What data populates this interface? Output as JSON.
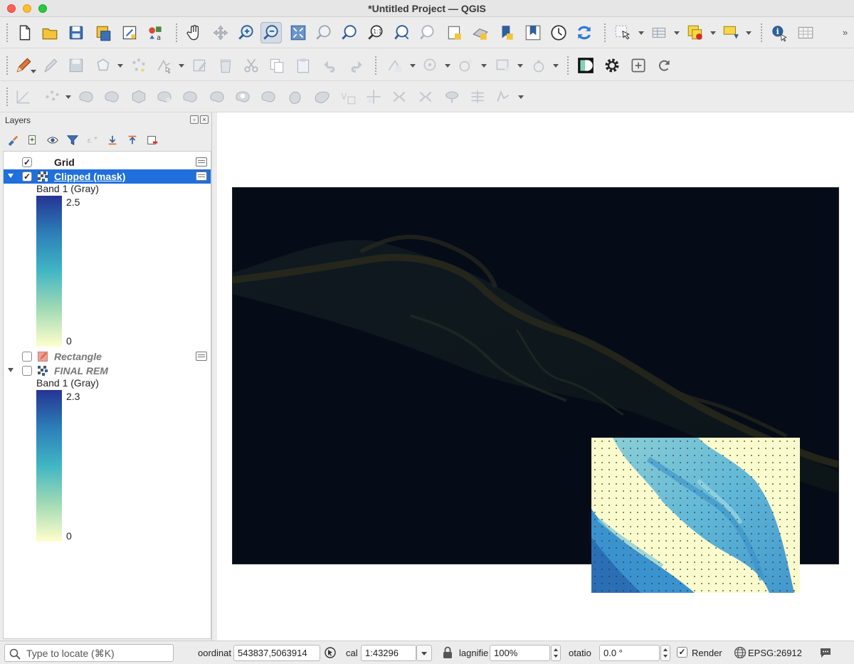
{
  "window": {
    "title": "*Untitled Project — QGIS"
  },
  "colors": {
    "accent": "#1f6fdc",
    "raster_bg": "#060b18",
    "ramp_top": "#253494",
    "ramp_bottom": "#ffffcc"
  },
  "toolbars": {
    "row1": [
      "new-project-icon",
      "open-project-icon",
      "save-project-icon",
      "save-as-icon",
      "print-layout-icon",
      "style-manager-icon",
      "pan-icon",
      "pan-to-selection-icon",
      "zoom-in-icon",
      "zoom-out-icon",
      "zoom-full-icon",
      "zoom-to-selection-icon",
      "zoom-to-layer-icon",
      "zoom-native-icon",
      "zoom-last-icon",
      "zoom-next-icon",
      "new-map-view-icon",
      "new-3d-map-view-icon",
      "new-bookmark-icon",
      "show-bookmarks-icon",
      "temporal-controller-icon",
      "refresh-icon",
      "select-features-icon",
      "attribute-table-icon",
      "deselect-icon",
      "annotation-icon",
      "identify-icon",
      "measure-icon"
    ],
    "row2": [
      "digitize-pencil-icon",
      "edit-pencil-icon",
      "save-edits-icon",
      "add-polygon-icon",
      "vertex-tool-icon",
      "node-tool-icon",
      "delete-selected-icon",
      "cut-icon",
      "copy-icon",
      "paste-icon",
      "undo-icon",
      "redo-icon",
      "label-icon",
      "label-pin-icon",
      "label-show-icon",
      "label-move-icon",
      "label-rotate-icon",
      "plugin-d-icon",
      "settings-gear-icon",
      "plugin-add-icon",
      "plugin-reload-icon"
    ],
    "row3": [
      "snapping-icon",
      "point-tool-icon",
      "reshape-icon",
      "split-icon",
      "merge-icon",
      "offset-icon",
      "rotate-icon",
      "simplify-icon",
      "add-ring-icon",
      "add-part-icon",
      "fill-ring-icon",
      "delete-ring-icon",
      "delete-part-icon",
      "vertex-edit-icon",
      "split-parts-icon",
      "trim-icon",
      "merge-attrs-icon",
      "reverse-line-icon",
      "tracing-icon"
    ]
  },
  "layers_panel": {
    "title": "Layers",
    "layers": [
      {
        "name": "Grid",
        "checked": true,
        "expanded": false,
        "style": "bold",
        "has_memory_icon": true
      },
      {
        "name": "Clipped (mask)",
        "checked": true,
        "expanded": true,
        "selected": true,
        "has_memory_icon": true,
        "legend": {
          "band": "Band 1 (Gray)",
          "max": "2.5",
          "min": "0"
        }
      },
      {
        "name": "Rectangle",
        "checked": false,
        "expanded": false,
        "style": "italic",
        "has_memory_icon": true
      },
      {
        "name": "FINAL REM",
        "checked": false,
        "expanded": true,
        "style": "italic",
        "legend": {
          "band": "Band 1 (Gray)",
          "max": "2.3",
          "min": "0"
        }
      }
    ]
  },
  "status_bar": {
    "locate_placeholder": "Type to locate (⌘K)",
    "coordinate_label": "oordinat",
    "coordinate_value": "543837,5063914",
    "scale_label": "cal",
    "scale_value": "1:43296",
    "magnifier_label": "lagnifie",
    "magnifier_value": "100%",
    "rotation_label": "otatio",
    "rotation_value": "0.0 °",
    "render_label": "Render",
    "render_checked": true,
    "crs": "EPSG:26912"
  }
}
